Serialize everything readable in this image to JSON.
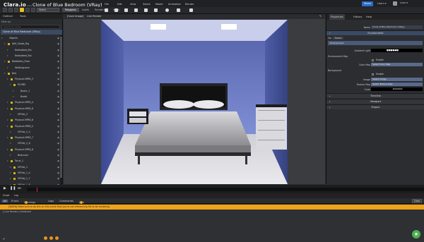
{
  "app": {
    "logo": "Clara.io",
    "logo_sub": "beta",
    "doc_title": "Clone of Blue Bedroom (VRay)"
  },
  "menu": [
    "File",
    "Edit",
    "View",
    "Select",
    "Model",
    "Animation",
    "Render"
  ],
  "header": {
    "share": "Share",
    "learn": "Learn ▾",
    "user": "Lxxx ▾"
  },
  "mode_select": "Select",
  "main_tabs": [
    "Polygons",
    "Lights",
    "Rendering",
    "VRay"
  ],
  "left": {
    "tabs": [
      "Outliner",
      "Tools"
    ],
    "filter_label": "Filter by:",
    "search_placeholder": "Search by name",
    "root": "Clone of Blue Bedroom (VRay)",
    "items": [
      "Objects",
      "AtM_Shake_Rig",
      "Redlodbed_Bln",
      "Redlodbed_Blo",
      "Bedtables_Floor",
      "Walkingroom",
      "Bed",
      "Physical-HPBS_3",
      "PX-PBS",
      "Bookc_1",
      "Brakti",
      "Physical-HPBS_4",
      "Physical-HPBS_6",
      "VPGtsl_3",
      "Physical-HPBS_6",
      "Physical-HPBS_2",
      "VPGtsl_2_4",
      "Physical-HPBS_7",
      "VPGtsl_2_8",
      "Physical-HPBS_8",
      "Bedcover",
      "Torus_1",
      "VPGtsl_1",
      "VPGtsl_1_4",
      "VPGtsl_1_7",
      "VPGtsl_1_8"
    ]
  },
  "viewport": {
    "save_image": "[Save Image]",
    "live_render": "Live Render"
  },
  "right": {
    "tabs": [
      "Properties",
      "History",
      "Help"
    ],
    "name_label": "Name",
    "name_value": "Clone of Blue Bedroom (VRay)",
    "section_environment": "Environment",
    "op_label": "Op:",
    "op_value": "Scene",
    "environment_row": "Environment",
    "ambient_label": "Ambient Light",
    "env_map_label": "Environment Map",
    "enable_label": "Enable",
    "color_map_label": "Color Map",
    "color_map_value": "Select Color Map",
    "background_label": "Background",
    "background_enable": "Enable",
    "image_label": "Image",
    "image_value": "Select Image",
    "texture_map_label": "Texture Map",
    "texture_map_value": "Select Texture Map",
    "color_label": "Color",
    "color_value": "#000000",
    "sections": [
      "Timeline",
      "Viewport",
      "Project"
    ]
  },
  "console": {
    "tabs": [
      "Script",
      "Log"
    ],
    "filters": [
      "All",
      "Errors",
      "Warnings",
      "Logs",
      "Commands",
      "Jobs"
    ],
    "warnings_count": "2",
    "jobs_count": "0",
    "clear": "Clear",
    "warning_text": "[WARN] Make sure to do this on this scene that you're not referencing file to be rendering",
    "log_text": "[ Live Render ] Initialized",
    "bottom_counts": [
      "0",
      "1",
      "0"
    ]
  },
  "colors": {
    "accent": "#e8c31a",
    "share": "#2a6cc9",
    "warning": "#f0a21b",
    "selection": "#3b4a63"
  }
}
